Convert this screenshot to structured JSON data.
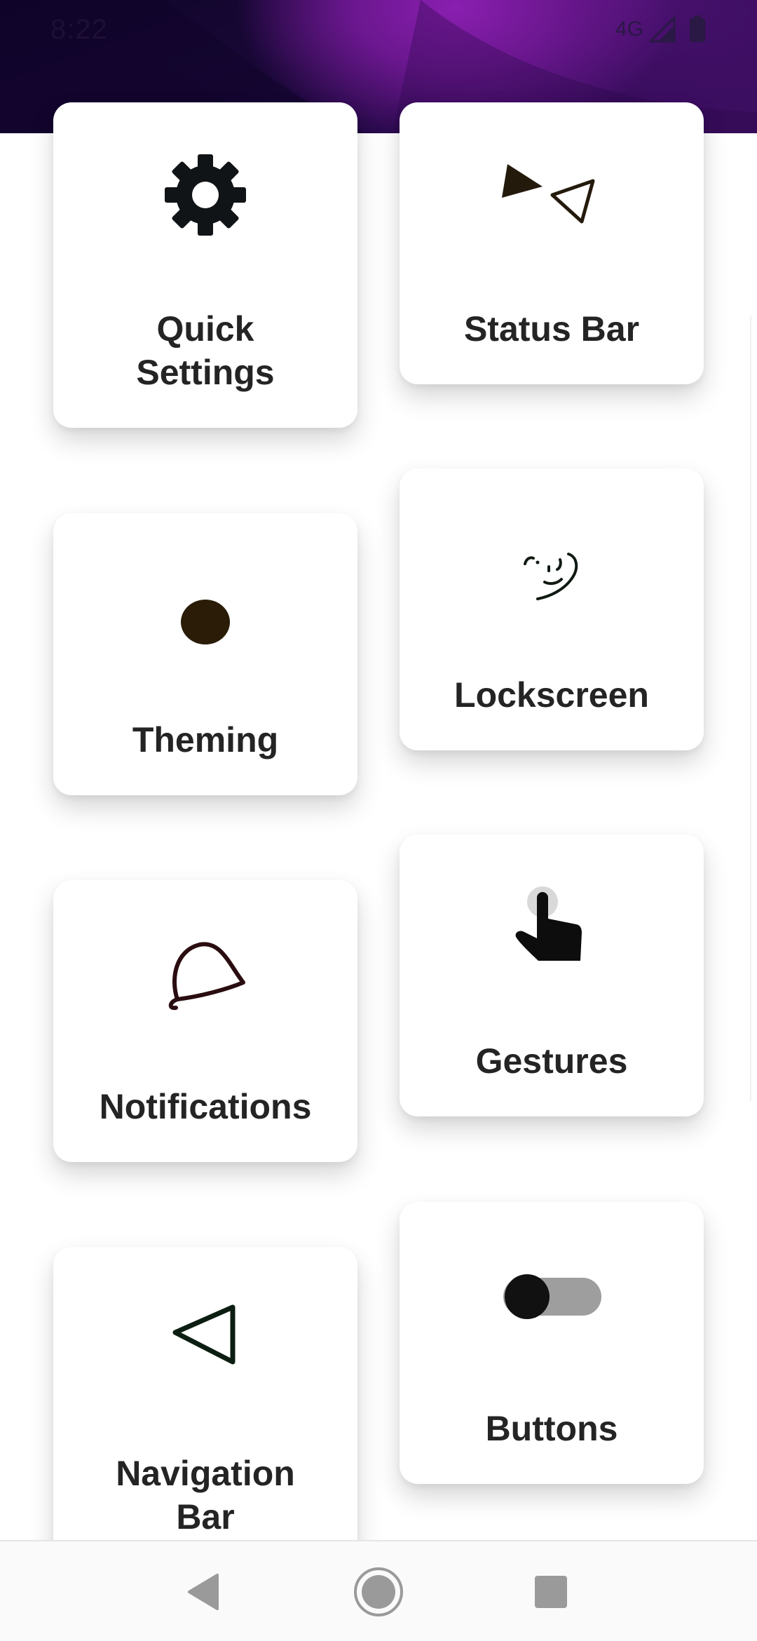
{
  "status_bar": {
    "time": "8:22",
    "network": "4G",
    "icons": [
      "signal-icon",
      "battery-icon"
    ]
  },
  "colors": {
    "header_dark": "#0e0428",
    "header_accent": "#8a1fb0",
    "card_bg": "#ffffff",
    "label_text": "#242424"
  },
  "cards": [
    {
      "id": "quick-settings",
      "label_line1": "Quick",
      "label_line2": "Settings",
      "icon": "gear-icon"
    },
    {
      "id": "status-bar",
      "label_line1": "Status Bar",
      "icon": "triangles-icon"
    },
    {
      "id": "theming",
      "label_line1": "Theming",
      "icon": "dot-icon"
    },
    {
      "id": "lockscreen",
      "label_line1": "Lockscreen",
      "icon": "face-icon"
    },
    {
      "id": "notifications",
      "label_line1": "Notifications",
      "icon": "bell-icon"
    },
    {
      "id": "gestures",
      "label_line1": "Gestures",
      "icon": "touch-icon"
    },
    {
      "id": "navigation-bar",
      "label_line1": "Navigation",
      "label_line2": "Bar",
      "icon": "back-triangle-icon"
    },
    {
      "id": "buttons",
      "label_line1": "Buttons",
      "icon": "toggle-icon"
    }
  ],
  "nav": {
    "back": "back-icon",
    "home": "home-icon",
    "recents": "recents-icon"
  }
}
